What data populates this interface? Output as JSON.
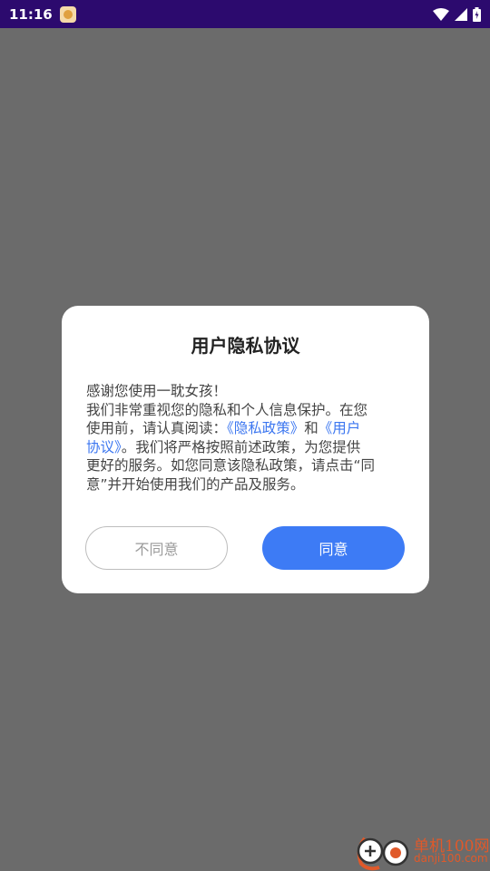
{
  "status_bar": {
    "time": "11:16",
    "icons": [
      "app-notification-icon",
      "wifi-icon",
      "signal-icon",
      "battery-icon"
    ],
    "background_color": "#2c0a6e"
  },
  "dialog": {
    "title": "用户隐私协议",
    "body_lines": [
      {
        "text": "感谢您使用一耽女孩！"
      },
      {
        "text": "我们非常重视您的隐私和个人信息保护。在您"
      },
      {
        "segments": [
          {
            "text": "使用前，请认真阅读：",
            "link": false
          },
          {
            "text": "《隐私政策》",
            "link": true
          },
          {
            "text": "和",
            "link": false
          },
          {
            "text": "《用户",
            "link": true
          }
        ]
      },
      {
        "segments": [
          {
            "text": "协议》",
            "link": true
          },
          {
            "text": "。我们将严格按照前述政策，为您提供",
            "link": false
          }
        ]
      },
      {
        "text": "更好的服务。如您同意该隐私政策，请点击“同"
      },
      {
        "text": "意”并开始使用我们的产品及服务。"
      }
    ],
    "disagree_label": "不同意",
    "agree_label": "同意",
    "accent_color": "#3d7bf5",
    "link_color": "#3b76f0"
  },
  "watermark": {
    "title": "单机100网",
    "domain": "danji100.com"
  }
}
